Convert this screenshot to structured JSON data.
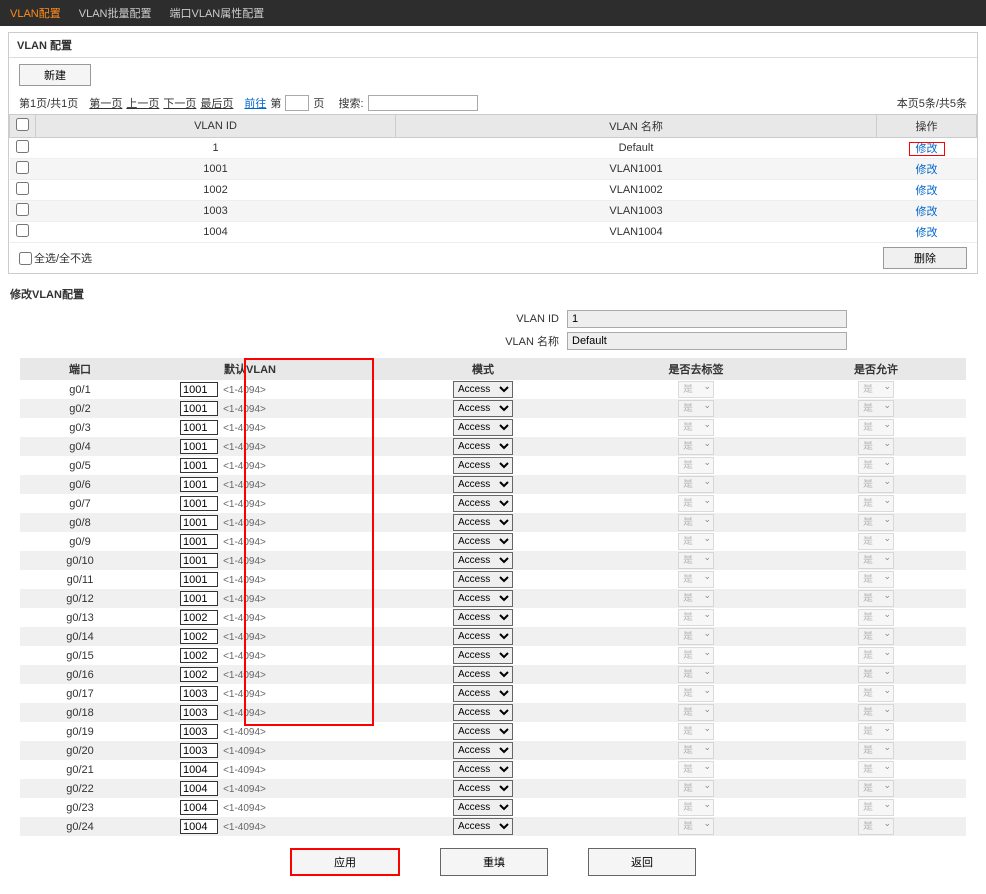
{
  "nav": {
    "tabs": [
      "VLAN配置",
      "VLAN批量配置",
      "端口VLAN属性配置"
    ],
    "active": 0
  },
  "vlan_list": {
    "title": "VLAN 配置",
    "new_btn": "新建",
    "pager": {
      "info": "第1页/共1页",
      "first": "第一页",
      "prev": "上一页",
      "next": "下一页",
      "last": "最后页",
      "goto": "前往",
      "page_unit_prefix": "第",
      "page_unit_suffix": "页",
      "search_label": "搜索:",
      "stats": "本页5条/共5条"
    },
    "headers": {
      "id": "VLAN ID",
      "name": "VLAN 名称",
      "action": "操作"
    },
    "rows": [
      {
        "id": "1",
        "name": "Default",
        "action": "修改",
        "highlighted": true
      },
      {
        "id": "1001",
        "name": "VLAN1001",
        "action": "修改"
      },
      {
        "id": "1002",
        "name": "VLAN1002",
        "action": "修改"
      },
      {
        "id": "1003",
        "name": "VLAN1003",
        "action": "修改"
      },
      {
        "id": "1004",
        "name": "VLAN1004",
        "action": "修改"
      }
    ],
    "select_all": "全选/全不选",
    "delete_btn": "删除"
  },
  "edit": {
    "title": "修改VLAN配置",
    "vlan_id_label": "VLAN ID",
    "vlan_id_value": "1",
    "vlan_name_label": "VLAN 名称",
    "vlan_name_value": "Default",
    "headers": {
      "port": "端口",
      "default_vlan": "默认VLAN",
      "mode": "模式",
      "untag": "是否去标签",
      "allow": "是否允许"
    },
    "hint": "<1-4094>",
    "mode_option": "Access",
    "yn_option": "是",
    "ports": [
      {
        "port": "g0/1",
        "vlan": "1001"
      },
      {
        "port": "g0/2",
        "vlan": "1001"
      },
      {
        "port": "g0/3",
        "vlan": "1001"
      },
      {
        "port": "g0/4",
        "vlan": "1001"
      },
      {
        "port": "g0/5",
        "vlan": "1001"
      },
      {
        "port": "g0/6",
        "vlan": "1001"
      },
      {
        "port": "g0/7",
        "vlan": "1001"
      },
      {
        "port": "g0/8",
        "vlan": "1001"
      },
      {
        "port": "g0/9",
        "vlan": "1001"
      },
      {
        "port": "g0/10",
        "vlan": "1001"
      },
      {
        "port": "g0/11",
        "vlan": "1001"
      },
      {
        "port": "g0/12",
        "vlan": "1001"
      },
      {
        "port": "g0/13",
        "vlan": "1002"
      },
      {
        "port": "g0/14",
        "vlan": "1002"
      },
      {
        "port": "g0/15",
        "vlan": "1002"
      },
      {
        "port": "g0/16",
        "vlan": "1002"
      },
      {
        "port": "g0/17",
        "vlan": "1003"
      },
      {
        "port": "g0/18",
        "vlan": "1003"
      },
      {
        "port": "g0/19",
        "vlan": "1003"
      },
      {
        "port": "g0/20",
        "vlan": "1003"
      },
      {
        "port": "g0/21",
        "vlan": "1004"
      },
      {
        "port": "g0/22",
        "vlan": "1004"
      },
      {
        "port": "g0/23",
        "vlan": "1004"
      },
      {
        "port": "g0/24",
        "vlan": "1004"
      }
    ]
  },
  "buttons": {
    "apply": "应用",
    "reset": "重填",
    "back": "返回"
  }
}
